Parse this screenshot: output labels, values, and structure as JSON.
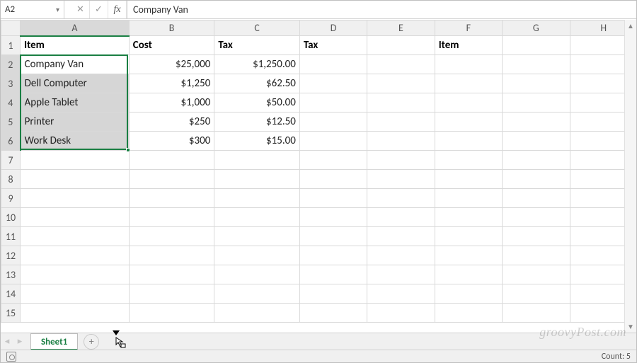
{
  "formula_bar": {
    "name_box": "A2",
    "cancel_glyph": "✕",
    "enter_glyph": "✓",
    "fx_glyph": "fx",
    "content": "Company Van"
  },
  "columns": [
    "A",
    "B",
    "C",
    "D",
    "E",
    "F",
    "G",
    "H"
  ],
  "visible_rows": 15,
  "headers": {
    "A": "Item",
    "B": "Cost",
    "C": "Tax",
    "D": "Tax",
    "E": "",
    "F": "Item",
    "G": "",
    "H": ""
  },
  "rows": [
    {
      "n": 2,
      "A": "Company Van",
      "B": "$25,000",
      "C": "$1,250.00"
    },
    {
      "n": 3,
      "A": "Dell Computer",
      "B": "$1,250",
      "C": "$62.50"
    },
    {
      "n": 4,
      "A": "Apple Tablet",
      "B": "$1,000",
      "C": "$50.00"
    },
    {
      "n": 5,
      "A": "Printer",
      "B": "$250",
      "C": "$12.50"
    },
    {
      "n": 6,
      "A": "Work Desk",
      "B": "$300",
      "C": "$15.00"
    }
  ],
  "selection": {
    "col": "A",
    "row_start": 2,
    "row_end": 6,
    "active_row": 2
  },
  "sheet_tabs": {
    "active": "Sheet1",
    "new_glyph": "+"
  },
  "status_bar": {
    "count_label": "Count: 5"
  },
  "watermark": "groovyPost.com",
  "chart_data": {
    "type": "table",
    "columns": [
      "Item",
      "Cost",
      "Tax"
    ],
    "rows": [
      [
        "Company Van",
        25000,
        1250.0
      ],
      [
        "Dell Computer",
        1250,
        62.5
      ],
      [
        "Apple Tablet",
        1000,
        50.0
      ],
      [
        "Printer",
        250,
        12.5
      ],
      [
        "Work Desk",
        300,
        15.0
      ]
    ],
    "extra_headers": {
      "D": "Tax",
      "F": "Item"
    }
  }
}
